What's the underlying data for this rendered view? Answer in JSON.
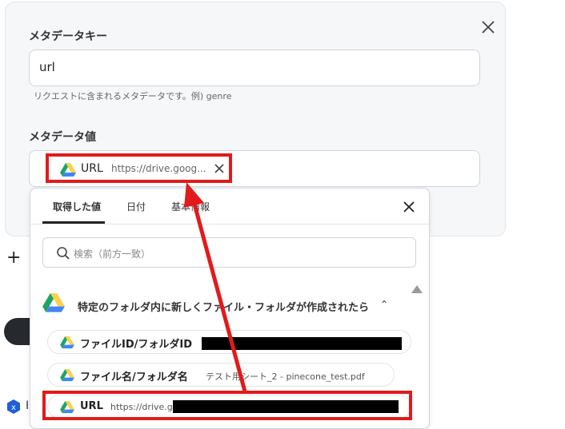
{
  "panel": {
    "key_label": "メタデータキー",
    "key_value": "url",
    "hint": "リクエストに含まれるメタデータです。例) genre",
    "value_label": "メタデータ値",
    "chip": {
      "label": "URL",
      "value": "https://drive.goog..."
    }
  },
  "dropdown": {
    "tabs": [
      "取得した値",
      "日付",
      "基本情報"
    ],
    "search_placeholder": "検索（前方一致）",
    "section_title": "特定のフォルダ内に新しくファイル・フォルダが作成されたら",
    "items": [
      {
        "label": "ファイルID/フォルダID",
        "value": ""
      },
      {
        "label": "ファイル名/フォルダ名",
        "value": "テスト用シート_2 - pinecone_test.pdf"
      },
      {
        "label": "URL",
        "value": "https://drive.g"
      }
    ]
  },
  "left": {
    "plus": "+",
    "glyph": "I"
  },
  "colors": {
    "highlight": "#e11b1b",
    "drive_green": "#1fa463",
    "drive_yellow": "#ffd04b",
    "drive_blue": "#4285f4"
  },
  "icons": [
    "close-icon",
    "google-drive-icon",
    "search-icon",
    "chevron-up-icon",
    "plus-icon"
  ]
}
